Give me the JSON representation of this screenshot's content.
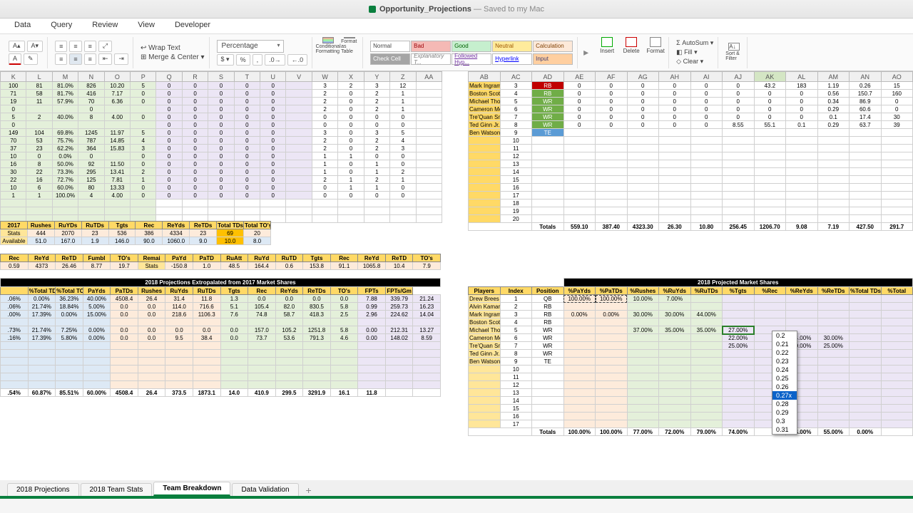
{
  "title": {
    "doc": "Opportunity_Projections",
    "suffix": "— Saved to my Mac"
  },
  "menu": [
    "Data",
    "Query",
    "Review",
    "View",
    "Developer"
  ],
  "ribbon": {
    "wrap": "Wrap Text",
    "merge": "Merge & Center",
    "numfmt": "Percentage",
    "condfmt": "Conditional Formatting",
    "fmtastbl": "Format as Table",
    "styles": {
      "r1": [
        "Normal",
        "Bad",
        "Good",
        "Neutral",
        "Calculation"
      ],
      "r2": [
        "Check Cell",
        "Explanatory T...",
        "Followed Hyp...",
        "Hyperlink",
        "Input"
      ]
    },
    "insert": "Insert",
    "delete": "Delete",
    "format": "Format",
    "autosum": "AutoSum",
    "fill": "Fill",
    "clear": "Clear",
    "sortfilter": "Sort & Filter"
  },
  "cols1": [
    "K",
    "L",
    "M",
    "N",
    "O",
    "P",
    "Q",
    "R",
    "S",
    "T",
    "U",
    "V",
    "W",
    "X",
    "Y",
    "Z",
    "AA"
  ],
  "cols2": [
    "AB",
    "AC",
    "AD",
    "AE",
    "AF",
    "AG",
    "AH",
    "AI",
    "AJ",
    "AK",
    "AL",
    "AM",
    "AN",
    "AO"
  ],
  "top": {
    "players": [
      "Mark Ingram",
      "Boston Scott",
      "Michael Thomas",
      "Cameron Meredith",
      "Tre'Quan Smith",
      "Ted Ginn Jr.",
      "Ben Watson"
    ],
    "idx": [
      3,
      4,
      5,
      6,
      7,
      8,
      9
    ],
    "pos": [
      "RB",
      "RB",
      "WR",
      "WR",
      "WR",
      "WR",
      "TE"
    ],
    "ae": [
      0,
      0,
      0,
      0,
      0,
      0,
      ""
    ],
    "af": [
      0,
      0,
      0,
      0,
      0,
      0,
      ""
    ],
    "ag": [
      0,
      0,
      0,
      0,
      0,
      0,
      ""
    ],
    "ah": [
      0,
      0,
      0,
      0,
      0,
      0,
      ""
    ],
    "ai": [
      0,
      0,
      0,
      0,
      0,
      0,
      ""
    ],
    "aj": [
      0,
      0,
      0,
      0,
      0,
      "8.55",
      ""
    ],
    "ak": [
      "43.2",
      0,
      0,
      0,
      0,
      "55.1",
      ""
    ],
    "al": [
      "183",
      0,
      0,
      0,
      0,
      "0.1",
      ""
    ],
    "am": [
      "1.19",
      "0.56",
      "0.34",
      "0.29",
      "0.1",
      "0.29",
      ""
    ],
    "an": [
      "0.26",
      "150.7",
      "86.9",
      "60.6",
      "17.4",
      "63.7",
      ""
    ],
    "ao": [
      "15",
      "160",
      "0",
      "0",
      "30",
      "39",
      ""
    ],
    "extra_idx": [
      10,
      11,
      12,
      13,
      14,
      15,
      16,
      17,
      18,
      19,
      20
    ],
    "totals_lbl": "Totals",
    "totals": {
      "ae": "559.10",
      "af": "387.40",
      "ag": "4323.30",
      "ah": "26.30",
      "ai": "10.80",
      "aj": "256.45",
      "ak": "1206.70",
      "al": "9.08",
      "am": "7.19",
      "an": "427.50",
      "ao": "291.7"
    }
  },
  "topleft": {
    "rows": [
      [
        "100",
        "81",
        "81.0%",
        "826",
        "10.20",
        "5",
        "0",
        "0",
        "0",
        "0",
        "0",
        "",
        "3",
        "2",
        "3",
        "12",
        ""
      ],
      [
        "71",
        "58",
        "81.7%",
        "416",
        "7.17",
        "0",
        "0",
        "0",
        "0",
        "0",
        "0",
        "",
        "2",
        "0",
        "2",
        "1",
        ""
      ],
      [
        "19",
        "11",
        "57.9%",
        "70",
        "6.36",
        "0",
        "0",
        "0",
        "0",
        "0",
        "0",
        "",
        "2",
        "0",
        "2",
        "1",
        ""
      ],
      [
        "0",
        "",
        "",
        "0",
        "",
        "",
        "0",
        "0",
        "0",
        "0",
        "0",
        "",
        "2",
        "0",
        "2",
        "1",
        ""
      ],
      [
        "5",
        "2",
        "40.0%",
        "8",
        "4.00",
        "0",
        "0",
        "0",
        "0",
        "0",
        "0",
        "",
        "0",
        "0",
        "0",
        "0",
        ""
      ],
      [
        "0",
        "",
        "",
        "",
        "",
        "",
        "0",
        "0",
        "0",
        "0",
        "0",
        "",
        "0",
        "0",
        "0",
        "0",
        ""
      ],
      [
        "149",
        "104",
        "69.8%",
        "1245",
        "11.97",
        "5",
        "0",
        "0",
        "0",
        "0",
        "0",
        "",
        "3",
        "0",
        "3",
        "5",
        ""
      ],
      [
        "70",
        "53",
        "75.7%",
        "787",
        "14.85",
        "4",
        "0",
        "0",
        "0",
        "0",
        "0",
        "",
        "2",
        "0",
        "2",
        "4",
        ""
      ],
      [
        "37",
        "23",
        "62.2%",
        "364",
        "15.83",
        "3",
        "0",
        "0",
        "0",
        "0",
        "0",
        "",
        "2",
        "0",
        "2",
        "3",
        ""
      ],
      [
        "10",
        "0",
        "0.0%",
        "0",
        "",
        "0",
        "0",
        "0",
        "0",
        "0",
        "0",
        "",
        "1",
        "1",
        "0",
        "0",
        ""
      ],
      [
        "16",
        "8",
        "50.0%",
        "92",
        "11.50",
        "0",
        "0",
        "0",
        "0",
        "0",
        "0",
        "",
        "1",
        "0",
        "1",
        "0",
        ""
      ],
      [
        "30",
        "22",
        "73.3%",
        "295",
        "13.41",
        "2",
        "0",
        "0",
        "0",
        "0",
        "0",
        "",
        "1",
        "0",
        "1",
        "2",
        ""
      ],
      [
        "22",
        "16",
        "72.7%",
        "125",
        "7.81",
        "1",
        "0",
        "0",
        "0",
        "0",
        "0",
        "",
        "2",
        "1",
        "2",
        "1",
        ""
      ],
      [
        "10",
        "6",
        "60.0%",
        "80",
        "13.33",
        "0",
        "0",
        "0",
        "0",
        "0",
        "0",
        "",
        "0",
        "1",
        "1",
        "0",
        ""
      ],
      [
        "1",
        "1",
        "100.0%",
        "4",
        "4.00",
        "0",
        "0",
        "0",
        "0",
        "0",
        "0",
        "",
        "0",
        "0",
        "0",
        "0",
        ""
      ]
    ]
  },
  "mid": {
    "h1": [
      "2017",
      "Rushes",
      "RuYDs",
      "RuTDs",
      "Tgts",
      "Rec",
      "ReYds",
      "ReTDs",
      "Total TDs",
      "Total TO's"
    ],
    "r1": [
      "Stats",
      "444",
      "2070",
      "23",
      "536",
      "386",
      "4334",
      "23",
      "69",
      "20"
    ],
    "r2": [
      "Available",
      "51.0",
      "167.0",
      "1.9",
      "146.0",
      "90.0",
      "1060.0",
      "9.0",
      "10.0",
      "8.0"
    ],
    "h2": [
      "Rec",
      "ReYd",
      "ReTD",
      "Fumbl",
      "TO's",
      "Remai",
      "PaYd",
      "PaTD",
      "RuAtt",
      "RuYd",
      "RuTD",
      "Tgts",
      "Rec",
      "ReYd",
      "ReTD",
      "TO's"
    ],
    "r3": [
      "0.59",
      "4373",
      "26.46",
      "8.77",
      "19.7",
      "Stats",
      "-150.8",
      "1.0",
      "48.5",
      "164.4",
      "0.6",
      "153.8",
      "91.1",
      "1065.8",
      "10.4",
      "7.9"
    ]
  },
  "proj": {
    "title": "2018 Projections Extropalated from 2017 Market Shares",
    "hdr": [
      "",
      "%Total TDs",
      "%Total TO's",
      "PaYds",
      "PaTDs",
      "Rushes",
      "RuYds",
      "RuTDs",
      "Tgts",
      "Rec",
      "ReYds",
      "ReTDs",
      "TO's",
      "FPTs",
      "FPTs/Gm"
    ],
    "rows": [
      [
        ".06%",
        "0.00%",
        "36.23%",
        "40.00%",
        "4508.4",
        "26.4",
        "31.4",
        "11.8",
        "1.3",
        "0.0",
        "0.0",
        "0.0",
        "0.0",
        "7.88",
        "339.79",
        "21.24"
      ],
      [
        ".06%",
        "21.74%",
        "18.84%",
        "5.00%",
        "0.0",
        "0.0",
        "114.0",
        "716.6",
        "5.1",
        "105.4",
        "82.0",
        "830.5",
        "5.8",
        "0.99",
        "259.73",
        "16.23"
      ],
      [
        ".00%",
        "17.39%",
        "0.00%",
        "15.00%",
        "0.0",
        "0.0",
        "218.6",
        "1106.3",
        "7.6",
        "74.8",
        "58.7",
        "418.3",
        "2.5",
        "2.96",
        "224.62",
        "14.04"
      ],
      [
        "",
        "",
        "",
        "",
        "",
        "",
        "",
        "",
        "",
        "",
        "",
        "",
        "",
        "",
        "",
        ""
      ],
      [
        ".73%",
        "21.74%",
        "7.25%",
        "0.00%",
        "0.0",
        "0.0",
        "0.0",
        "0.0",
        "0.0",
        "157.0",
        "105.2",
        "1251.8",
        "5.8",
        "0.00",
        "212.31",
        "13.27"
      ],
      [
        ".16%",
        "17.39%",
        "5.80%",
        "0.00%",
        "0.0",
        "0.0",
        "9.5",
        "38.4",
        "0.0",
        "73.7",
        "53.6",
        "791.3",
        "4.6",
        "0.00",
        "148.02",
        "8.59"
      ]
    ],
    "tot": [
      ".54%",
      "60.87%",
      "85.51%",
      "60.00%",
      "4508.4",
      "26.4",
      "373.5",
      "1873.1",
      "14.0",
      "410.9",
      "299.5",
      "3291.9",
      "16.1",
      "11.8",
      "",
      ""
    ]
  },
  "ms": {
    "title": "2018 Projected Market Shares",
    "hdr": [
      "Players",
      "Index",
      "Position",
      "%PaYds",
      "%PaTDs",
      "%Rushes",
      "%RuYds",
      "%RuTDs",
      "%Tgts",
      "%Rec",
      "%ReYds",
      "%ReTDs",
      "%Total TDs",
      "%Total"
    ],
    "rows": [
      [
        "Drew Brees",
        "1",
        "QB",
        "100.00%",
        "100.00%",
        "10.00%",
        "7.00%",
        "",
        "",
        "",
        "",
        "",
        "",
        ""
      ],
      [
        "Alvin Kamara",
        "2",
        "RB",
        "",
        "",
        "",
        "",
        "",
        "",
        "",
        "",
        "",
        "",
        ""
      ],
      [
        "Mark Ingram",
        "3",
        "RB",
        "0.00%",
        "0.00%",
        "30.00%",
        "30.00%",
        "44.00%",
        "",
        "",
        "",
        "",
        "",
        ""
      ],
      [
        "Boston Scott",
        "4",
        "RB",
        "",
        "",
        "",
        "",
        "",
        "",
        "",
        "",
        "",
        "",
        ""
      ],
      [
        "Michael Thomas",
        "5",
        "WR",
        "",
        "",
        "37.00%",
        "35.00%",
        "35.00%",
        "27.00%",
        "",
        "",
        "",
        "",
        ""
      ],
      [
        "Cameron Meredith",
        "6",
        "WR",
        "",
        "",
        "",
        "",
        "",
        "22.00%",
        "",
        "24.00%",
        "30.00%",
        "",
        ""
      ],
      [
        "Tre'Quan Smith",
        "7",
        "WR",
        "",
        "",
        "",
        "",
        "",
        "25.00%",
        "",
        "20.00%",
        "25.00%",
        "",
        ""
      ],
      [
        "Ted Ginn Jr.",
        "8",
        "WR",
        "",
        "",
        "",
        "",
        "",
        "",
        "",
        "",
        "",
        "",
        ""
      ],
      [
        "Ben Watson",
        "9",
        "TE",
        "",
        "",
        "",
        "",
        "",
        "",
        "",
        "",
        "",
        "",
        ""
      ]
    ],
    "extra_idx": [
      10,
      11,
      12,
      13,
      14,
      15,
      16,
      17
    ],
    "totals_lbl": "Totals",
    "tot": [
      "100.00%",
      "100.00%",
      "77.00%",
      "72.00%",
      "79.00%",
      "74.00%",
      "",
      "44.00%",
      "55.00%",
      "0.00%",
      ""
    ]
  },
  "dd": {
    "opts": [
      "0.2",
      "0.21",
      "0.22",
      "0.23",
      "0.24",
      "0.25",
      "0.26",
      "0.27x",
      "0.28",
      "0.29",
      "0.3",
      "0.31"
    ],
    "sel": 7
  },
  "sheets": [
    "2018 Projections",
    "2018 Team Stats",
    "Team Breakdown",
    "Data Validation"
  ],
  "activeSheet": 2
}
